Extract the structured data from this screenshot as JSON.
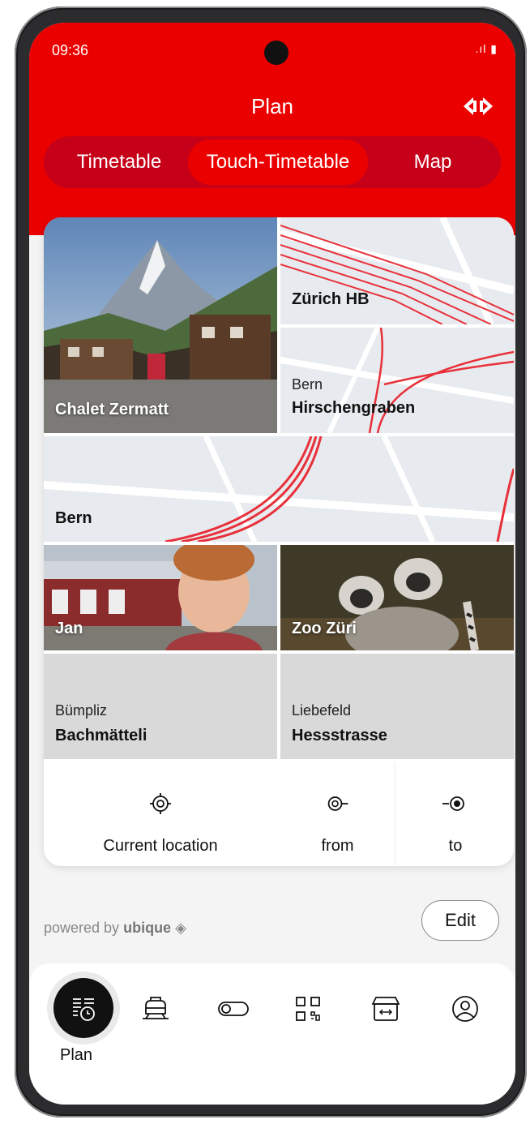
{
  "status": {
    "time": "09:36",
    "signal": ".ıl ▮"
  },
  "header": {
    "title": "Plan"
  },
  "tabs": [
    {
      "label": "Timetable"
    },
    {
      "label": "Touch-Timetable"
    },
    {
      "label": "Map"
    }
  ],
  "tiles": {
    "zermatt": {
      "label": "Chalet Zermatt"
    },
    "zurich": {
      "label": "Zürich HB"
    },
    "bern_hirschengraben": {
      "sub": "Bern",
      "label": "Hirschengraben"
    },
    "bern": {
      "label": "Bern"
    },
    "jan": {
      "label": "Jan"
    },
    "zoo": {
      "label": "Zoo Züri"
    },
    "bachmatteli": {
      "sub": "Bümpliz",
      "label": "Bachmätteli"
    },
    "hessstrasse": {
      "sub": "Liebefeld",
      "label": "Hessstrasse"
    }
  },
  "actions": {
    "current_location": "Current location",
    "from": "from",
    "to": "to"
  },
  "footer": {
    "powered_prefix": "powered by",
    "powered_brand": "ubique",
    "edit_label": "Edit"
  },
  "bottom_nav": {
    "plan_label": "Plan"
  },
  "colors": {
    "brand_red": "#eb0000",
    "dark_red": "#c60018"
  }
}
